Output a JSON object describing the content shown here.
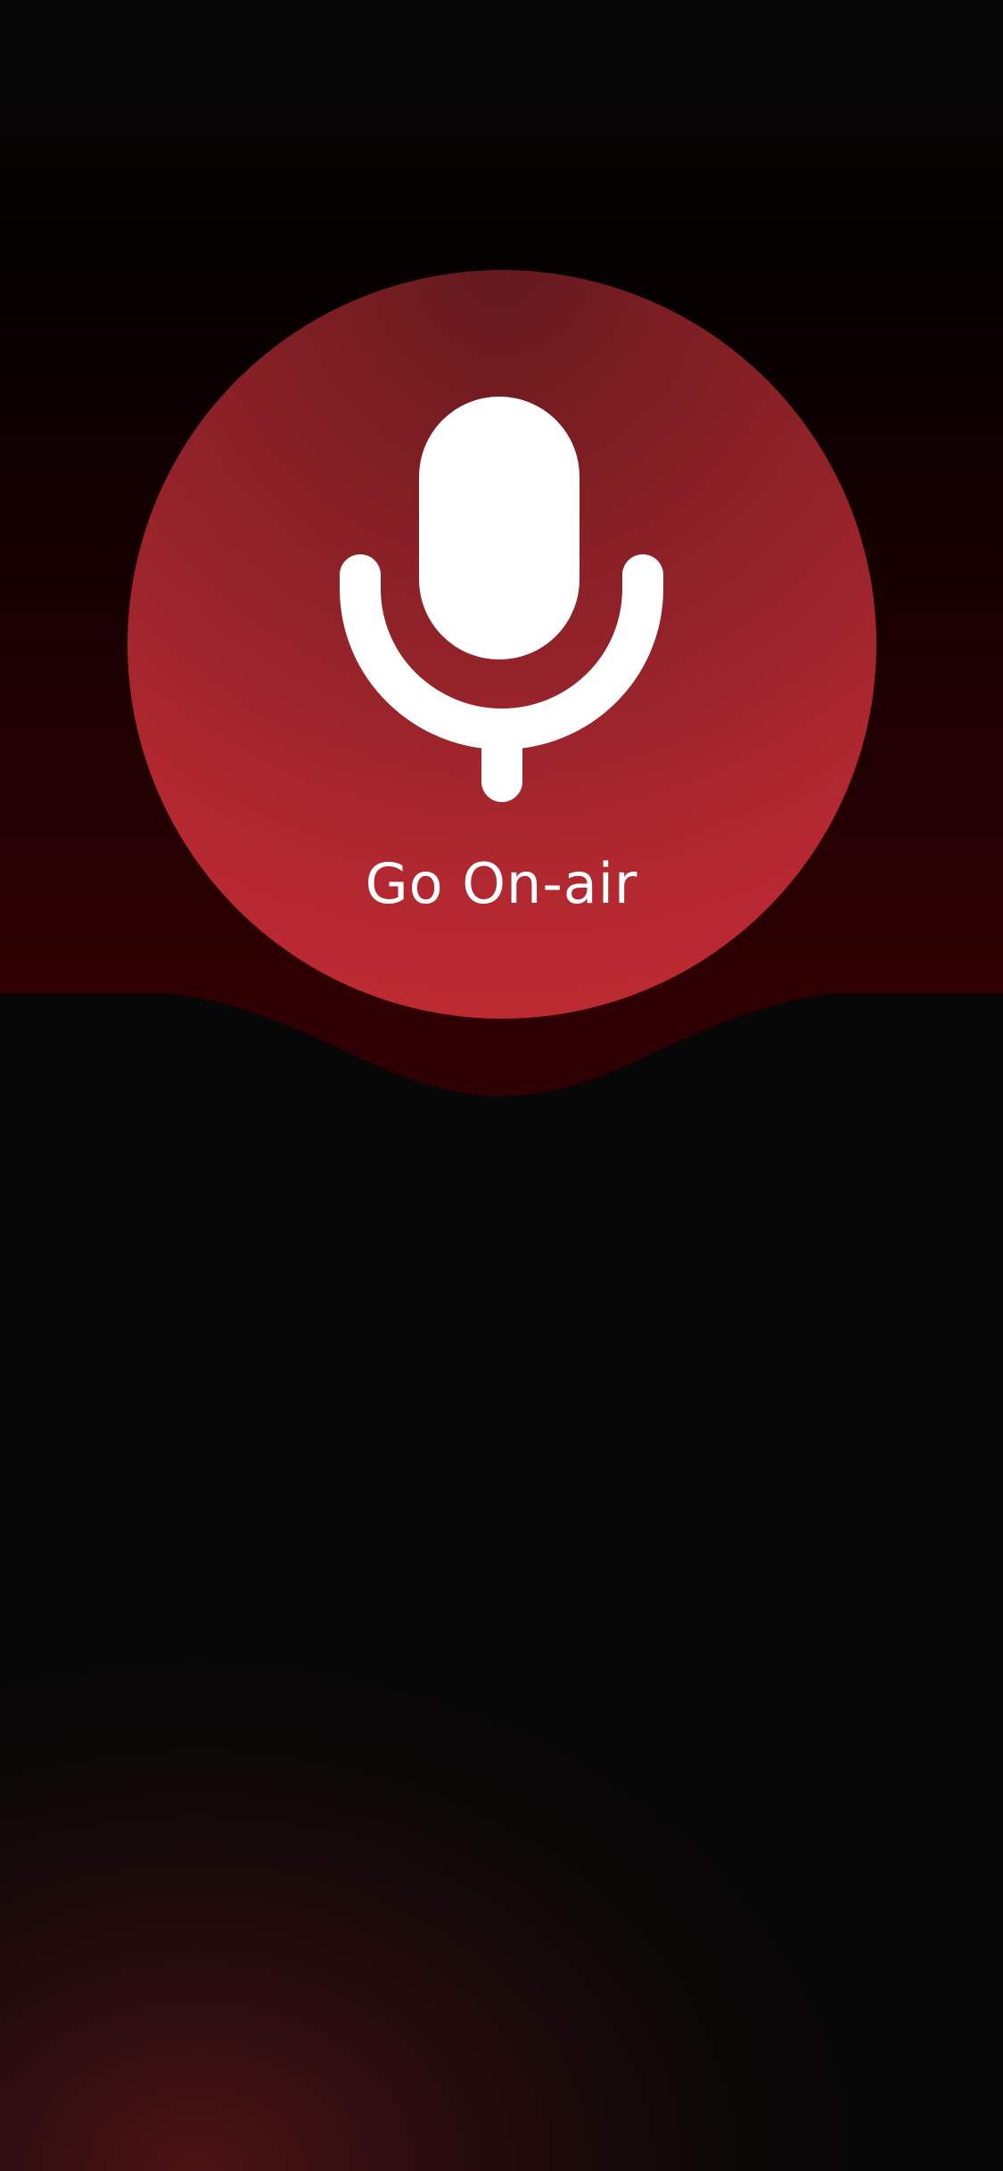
{
  "record": {
    "label": "Go On-air",
    "icon": "microphone-icon"
  },
  "colors": {
    "background": "#070707",
    "accent": "#c52b33",
    "wave": "#2e0003"
  }
}
